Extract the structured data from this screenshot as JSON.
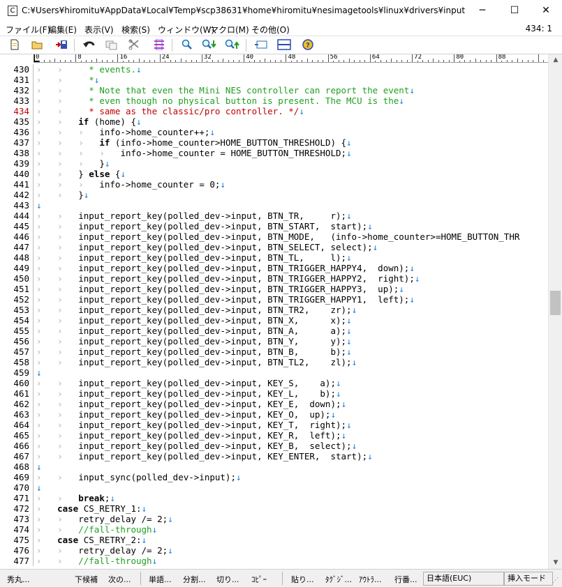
{
  "window": {
    "icon_glyph": "C",
    "title": "C:¥Users¥hiromitu¥AppData¥Local¥Temp¥scp38631¥home¥hiromitu¥nesimagetools¥linux¥drivers¥input¥joystick¥clove..."
  },
  "menu": {
    "items": [
      "ファイル(F)",
      "編集(E)",
      "表示(V)",
      "検索(S)",
      "ウィンドウ(W)",
      "マクロ(M)",
      "その他(O)"
    ],
    "cursor_position": "434: 1"
  },
  "toolbar": {
    "icons": [
      "new-file-icon",
      "open-folder-icon",
      "save-icon",
      "undo-icon",
      "copy-icon",
      "cut-icon",
      "paste-icon",
      "find-icon",
      "find-next-icon",
      "find-prev-icon",
      "grep-icon",
      "split-window-icon",
      "help-icon"
    ]
  },
  "ruler": {
    "labels": [
      "0",
      "8",
      "16",
      "24",
      "32",
      "40",
      "48",
      "56",
      "64",
      "72",
      "80",
      "88"
    ]
  },
  "editor": {
    "current_line": 434,
    "colors": {
      "comment": "#20a020",
      "current_line_number": "#c00000",
      "newline_mark": "#2080e0",
      "tab_mark": "#b0b0b0"
    },
    "lines": [
      {
        "n": "430",
        "indent": 2,
        "text": "  * events.",
        "type": "comment"
      },
      {
        "n": "431",
        "indent": 2,
        "text": "  *",
        "type": "comment"
      },
      {
        "n": "432",
        "indent": 2,
        "text": "  * Note that even the Mini NES controller can report the event",
        "type": "comment"
      },
      {
        "n": "433",
        "indent": 2,
        "text": "  * even though no physical button is present. The MCU is the",
        "type": "comment"
      },
      {
        "n": "434",
        "indent": 2,
        "text": "  * same as the classic/pro controller. */",
        "type": "comment-current"
      },
      {
        "n": "435",
        "indent": 2,
        "text": "if (home) {",
        "type": "kw-if"
      },
      {
        "n": "436",
        "indent": 3,
        "text": "info->home_counter++;",
        "type": "code"
      },
      {
        "n": "437",
        "indent": 3,
        "text": "if (info->home_counter>HOME_BUTTON_THRESHOLD) {",
        "type": "kw-if"
      },
      {
        "n": "438",
        "indent": 4,
        "text": "info->home_counter = HOME_BUTTON_THRESHOLD;",
        "type": "code"
      },
      {
        "n": "439",
        "indent": 3,
        "text": "}",
        "type": "code"
      },
      {
        "n": "440",
        "indent": 2,
        "text": "} else {",
        "type": "kw-else"
      },
      {
        "n": "441",
        "indent": 3,
        "text": "info->home_counter = 0;",
        "type": "code"
      },
      {
        "n": "442",
        "indent": 2,
        "text": "}",
        "type": "code"
      },
      {
        "n": "443",
        "indent": 0,
        "text": "",
        "type": "code"
      },
      {
        "n": "444",
        "indent": 2,
        "text": "input_report_key(polled_dev->input, BTN_TR,     r);",
        "type": "code"
      },
      {
        "n": "445",
        "indent": 2,
        "text": "input_report_key(polled_dev->input, BTN_START,  start);",
        "type": "code"
      },
      {
        "n": "446",
        "indent": 2,
        "text": "input_report_key(polled_dev->input, BTN_MODE,   (info->home_counter>=HOME_BUTTON_THR",
        "type": "code",
        "truncated": true
      },
      {
        "n": "447",
        "indent": 2,
        "text": "input_report_key(polled_dev->input, BTN_SELECT, select);",
        "type": "code"
      },
      {
        "n": "448",
        "indent": 2,
        "text": "input_report_key(polled_dev->input, BTN_TL,     l);",
        "type": "code"
      },
      {
        "n": "449",
        "indent": 2,
        "text": "input_report_key(polled_dev->input, BTN_TRIGGER_HAPPY4,  down);",
        "type": "code"
      },
      {
        "n": "450",
        "indent": 2,
        "text": "input_report_key(polled_dev->input, BTN_TRIGGER_HAPPY2,  right);",
        "type": "code"
      },
      {
        "n": "451",
        "indent": 2,
        "text": "input_report_key(polled_dev->input, BTN_TRIGGER_HAPPY3,  up);",
        "type": "code"
      },
      {
        "n": "452",
        "indent": 2,
        "text": "input_report_key(polled_dev->input, BTN_TRIGGER_HAPPY1,  left);",
        "type": "code"
      },
      {
        "n": "453",
        "indent": 2,
        "text": "input_report_key(polled_dev->input, BTN_TR2,    zr);",
        "type": "code"
      },
      {
        "n": "454",
        "indent": 2,
        "text": "input_report_key(polled_dev->input, BTN_X,      x);",
        "type": "code"
      },
      {
        "n": "455",
        "indent": 2,
        "text": "input_report_key(polled_dev->input, BTN_A,      a);",
        "type": "code"
      },
      {
        "n": "456",
        "indent": 2,
        "text": "input_report_key(polled_dev->input, BTN_Y,      y);",
        "type": "code"
      },
      {
        "n": "457",
        "indent": 2,
        "text": "input_report_key(polled_dev->input, BTN_B,      b);",
        "type": "code"
      },
      {
        "n": "458",
        "indent": 2,
        "text": "input_report_key(polled_dev->input, BTN_TL2,    zl);",
        "type": "code"
      },
      {
        "n": "459",
        "indent": 0,
        "text": "",
        "type": "code"
      },
      {
        "n": "460",
        "indent": 2,
        "text": "input_report_key(polled_dev->input, KEY_S,    a);",
        "type": "code"
      },
      {
        "n": "461",
        "indent": 2,
        "text": "input_report_key(polled_dev->input, KEY_L,    b);",
        "type": "code"
      },
      {
        "n": "462",
        "indent": 2,
        "text": "input_report_key(polled_dev->input, KEY_E,  down);",
        "type": "code"
      },
      {
        "n": "463",
        "indent": 2,
        "text": "input_report_key(polled_dev->input, KEY_O,  up);",
        "type": "code"
      },
      {
        "n": "464",
        "indent": 2,
        "text": "input_report_key(polled_dev->input, KEY_T,  right);",
        "type": "code"
      },
      {
        "n": "465",
        "indent": 2,
        "text": "input_report_key(polled_dev->input, KEY_R,  left);",
        "type": "code"
      },
      {
        "n": "466",
        "indent": 2,
        "text": "input_report_key(polled_dev->input, KEY_B,  select);",
        "type": "code"
      },
      {
        "n": "467",
        "indent": 2,
        "text": "input_report_key(polled_dev->input, KEY_ENTER,  start);",
        "type": "code"
      },
      {
        "n": "468",
        "indent": 0,
        "text": "",
        "type": "code"
      },
      {
        "n": "469",
        "indent": 2,
        "text": "input_sync(polled_dev->input);",
        "type": "code"
      },
      {
        "n": "470",
        "indent": 0,
        "text": "",
        "type": "code"
      },
      {
        "n": "471",
        "indent": 2,
        "text": "break;",
        "type": "kw-break"
      },
      {
        "n": "472",
        "indent": 1,
        "text": "case CS_RETRY_1:",
        "type": "kw-case"
      },
      {
        "n": "473",
        "indent": 2,
        "text": "retry_delay /= 2;",
        "type": "code"
      },
      {
        "n": "474",
        "indent": 2,
        "text": "//fall-through",
        "type": "comment"
      },
      {
        "n": "475",
        "indent": 1,
        "text": "case CS_RETRY_2:",
        "type": "kw-case"
      },
      {
        "n": "476",
        "indent": 2,
        "text": "retry_delay /= 2;",
        "type": "code"
      },
      {
        "n": "477",
        "indent": 2,
        "text": "//fall-through",
        "type": "comment"
      }
    ]
  },
  "statusbar": {
    "items": [
      "秀丸...",
      "下候補",
      "次の...",
      "単語...",
      "分割...",
      "切り...",
      "ｺﾋﾟｰ",
      "貼り...",
      "ﾀｸﾞｼﾞ...",
      "ｱｳﾄﾗ...",
      "行番..."
    ],
    "encoding": "日本語(EUC)",
    "mode": "挿入モード"
  }
}
